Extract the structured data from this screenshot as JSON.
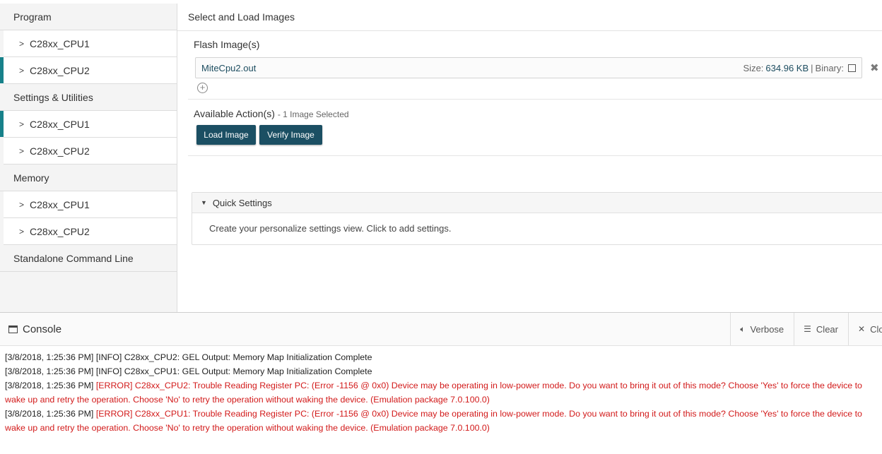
{
  "sidebar": {
    "sections": [
      {
        "header": "Program",
        "items": [
          {
            "label": "C28xx_CPU1"
          },
          {
            "label": "C28xx_CPU2"
          }
        ]
      },
      {
        "header": "Settings & Utilities",
        "items": [
          {
            "label": "C28xx_CPU1"
          },
          {
            "label": "C28xx_CPU2"
          }
        ]
      },
      {
        "header": "Memory",
        "items": [
          {
            "label": "C28xx_CPU1"
          },
          {
            "label": "C28xx_CPU2"
          }
        ]
      },
      {
        "header": "Standalone Command Line"
      }
    ],
    "chevron": ">",
    "accent_color": "#17818a"
  },
  "main": {
    "title": "Select and Load Images",
    "flash_label": "Flash Image(s)",
    "file": {
      "name": "MiteCpu2.out",
      "size_label": "Size:",
      "size_value": "634.96 KB",
      "separator": "|",
      "binary_label": "Binary:"
    },
    "icons": {
      "remove": "close-x-icon",
      "add": "add-circle-icon"
    },
    "actions_label": "Available Action(s)",
    "actions_sub": "- 1 Image Selected",
    "buttons": {
      "load": "Load Image",
      "verify": "Verify Image"
    },
    "button_color": "#1b4f63",
    "quick_settings": {
      "title": "Quick Settings",
      "body": "Create your personalize settings view. Click to add settings."
    }
  },
  "console": {
    "title": "Console",
    "tools": {
      "verbose": "Verbose",
      "clear": "Clear",
      "close": "Clo"
    },
    "error_color": "#d21a1a",
    "lines": [
      {
        "prefix": "[3/8/2018, 1:25:36 PM] [INFO] C28xx_CPU2: GEL Output: Memory Map Initialization Complete",
        "error": ""
      },
      {
        "prefix": "[3/8/2018, 1:25:36 PM] [INFO] C28xx_CPU1: GEL Output: Memory Map Initialization Complete",
        "error": ""
      },
      {
        "prefix": "[3/8/2018, 1:25:36 PM] ",
        "error": "[ERROR] C28xx_CPU2: Trouble Reading Register PC: (Error -1156 @ 0x0) Device may be operating in low-power mode. Do you want to bring it out of this mode? Choose 'Yes' to force the device to wake up and retry the operation. Choose 'No' to retry the operation without waking the device. (Emulation package 7.0.100.0)"
      },
      {
        "prefix": "[3/8/2018, 1:25:36 PM] ",
        "error": "[ERROR] C28xx_CPU1: Trouble Reading Register PC: (Error -1156 @ 0x0) Device may be operating in low-power mode. Do you want to bring it out of this mode? Choose 'Yes' to force the device to wake up and retry the operation. Choose 'No' to retry the operation without waking the device. (Emulation package 7.0.100.0)"
      }
    ]
  }
}
